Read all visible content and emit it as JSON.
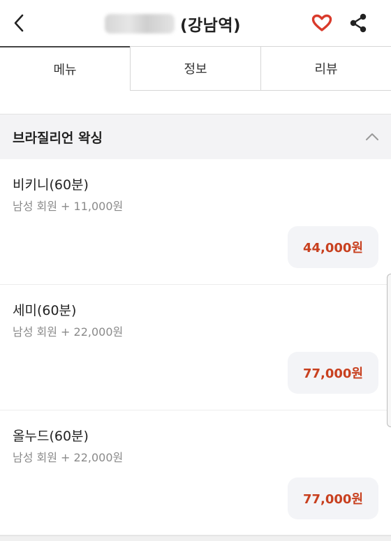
{
  "header": {
    "title_suffix": "(강남역)",
    "icons": {
      "back": "chevron-left-icon",
      "favorite": "heart-icon",
      "share": "share-icon"
    },
    "favorite_color": "#d93a2b"
  },
  "tabs": [
    {
      "label": "메뉴",
      "active": true
    },
    {
      "label": "정보",
      "active": false
    },
    {
      "label": "리뷰",
      "active": false
    }
  ],
  "section": {
    "title": "브라질리언 왁싱",
    "expanded": true
  },
  "items": [
    {
      "name": "비키니(60분)",
      "sub": "남성 회원 + 11,000원",
      "price": "44,000원"
    },
    {
      "name": "세미(60분)",
      "sub": "남성 회원 + 22,000원",
      "price": "77,000원"
    },
    {
      "name": "올누드(60분)",
      "sub": "남성 회원 + 22,000원",
      "price": "77,000원"
    }
  ],
  "colors": {
    "price": "#c8401f",
    "price_bg": "#f3f4f7",
    "section_bg": "#f3f3f5"
  }
}
